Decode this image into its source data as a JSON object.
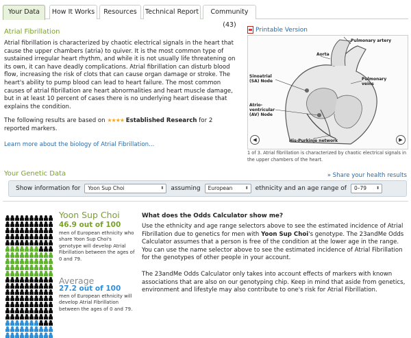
{
  "tabs": [
    {
      "label": "Your Data",
      "active": true
    },
    {
      "label": "How It Works",
      "active": false
    },
    {
      "label": "Resources",
      "active": false
    },
    {
      "label": "Technical Report",
      "active": false
    },
    {
      "label": "Community (43)",
      "active": false
    }
  ],
  "condition": {
    "title": "Atrial Fibrillation",
    "description": "Atrial fibrillation is characterized by chaotic electrical signals in the heart that cause the upper chambers (atria) to quiver. It is the most common type of sustained irregular heart rhythm, and while it is not usually life threatening on its own, it can have deadly complications. Atrial fibrillation can disturb blood flow, increasing the risk of clots that can cause organ damage or stroke. The heart's ability to pump blood can lead to heart failure. The most common causes of atrial fibrillation are heart abnormalities and heart muscle damage, but in at least 10 percent of cases there is no underlying heart disease that explains the condition.",
    "results_prefix": "The following results are based on",
    "stars": "★★★★",
    "research_label": "Established Research",
    "results_suffix": "for 2 reported markers.",
    "learn_more": "Learn more about the biology of Atrial Fibrillation..."
  },
  "illustration": {
    "print_label": "Printable Version",
    "caption": "1 of 3. Atrial fibrillation is characterized by chaotic electrical signals in the upper chambers of the heart.",
    "labels": {
      "aorta": "Aorta",
      "pulmonary_artery": "Pulmonary artery",
      "sa_node": "Sinoatrial (SA) Node",
      "pulmonary_veins": "Pulmonary veins",
      "av_node": "Atrio-ventricular (AV) Node",
      "his_purkinje": "His-Purkinje network"
    },
    "prev_icon": "left-arrow-icon",
    "next_icon": "right-arrow-icon"
  },
  "genetic": {
    "title": "Your Genetic Data",
    "share_link": "» Share your health results",
    "show_info_label": "Show information for",
    "person_value": "Yoon Sup Choi",
    "assuming_label": "assuming",
    "ethnicity_value": "European",
    "ethnicity_suffix": "ethnicity and an age range of",
    "age_value": "0–79"
  },
  "profiles": [
    {
      "name": "Yoon Sup Choi",
      "score": "46.9 out of 100",
      "description": "men of European ethnicity who share Yoon Sup Choi's genotype will develop Atrial Fibrillation between the ages of 0 and 79.",
      "highlight_count": 47,
      "color": "#5fb32e"
    },
    {
      "name": "Average",
      "score": "27.2 out of 100",
      "description": "men of European ethnicity will develop Atrial Fibrillation between the ages of 0 and 79.",
      "highlight_count": 27,
      "color": "#2f8fd8"
    }
  ],
  "odds": {
    "title": "What does the Odds Calculator show me?",
    "para1_a": "Use the ethnicity and age range selectors above to see the estimated incidence of Atrial Fibrillation due to genetics for men with",
    "para1_name": "Yoon Sup Choi",
    "para1_b": "'s genotype. The 23andMe Odds Calculator assumes that a person is free of the condition at the lower age in the range. You can use the name selector above to see the estimated incidence of Atrial Fibrillation for the genotypes of other people in your account.",
    "para2": "The 23andMe Odds Calculator only takes into account effects of markers with known associations that are also on our genotyping chip. Keep in mind that aside from genetics, environment and lifestyle may also contribute to one's risk for Atrial Fibrillation."
  },
  "colors": {
    "accent_green": "#79a02a",
    "link_blue": "#2a6aa8",
    "person_gray": "#0d0d0d"
  }
}
